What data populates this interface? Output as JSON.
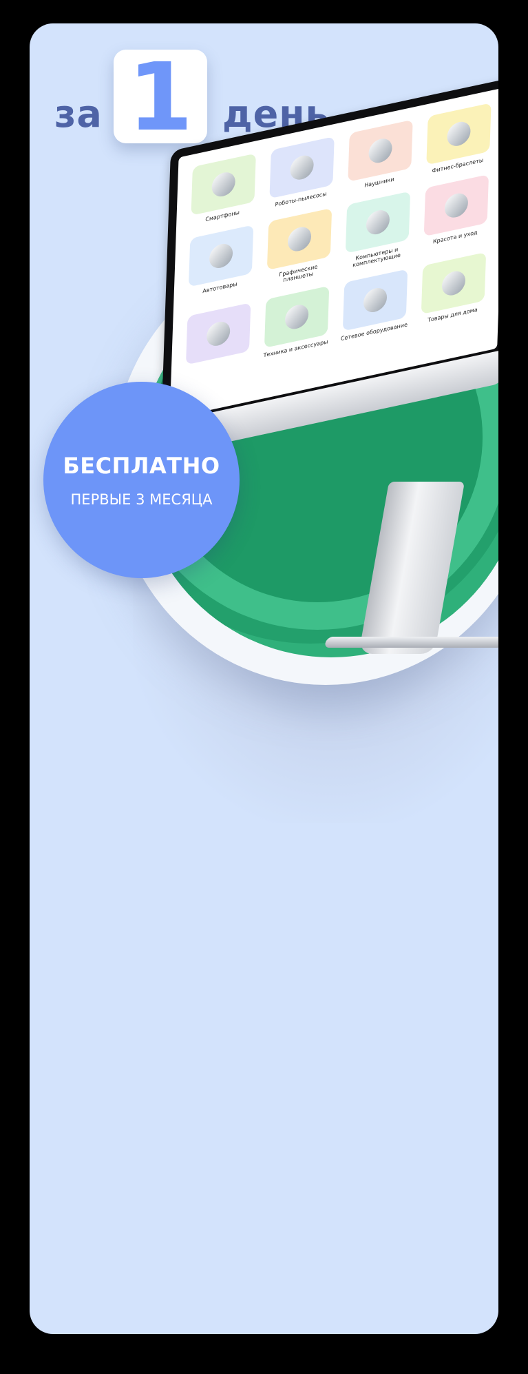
{
  "headline": {
    "prefix": "за",
    "number": "1",
    "suffix": "день"
  },
  "badge": {
    "title": "БЕСПЛАТНО",
    "subtitle": "ПЕРВЫЕ 3 МЕСЯЦА"
  },
  "screen": {
    "categories": [
      {
        "label": "Смартфоны",
        "color": "#e3f5d5",
        "icon": "smartphone-icon"
      },
      {
        "label": "Роботы-пылесосы",
        "color": "#dde4fb",
        "icon": "robot-vacuum-icon"
      },
      {
        "label": "Наушники",
        "color": "#fbe0d6",
        "icon": "earbuds-icon"
      },
      {
        "label": "Фитнес-браслеты",
        "color": "#fbf2b8",
        "icon": "fitness-band-icon"
      },
      {
        "label": "Автотовары",
        "color": "#dceafc",
        "icon": "car-mount-icon"
      },
      {
        "label": "Графические планшеты",
        "color": "#fde9b7",
        "icon": "tablet-icon"
      },
      {
        "label": "Компьютеры и комплектующие",
        "color": "#d8f5ea",
        "icon": "mouse-icon"
      },
      {
        "label": "Красота и уход",
        "color": "#fbdce3",
        "icon": "mirror-icon"
      },
      {
        "label": "",
        "color": "#e6def9",
        "icon": "washing-machine-icon"
      },
      {
        "label": "Техника и аксессуары",
        "color": "#d4f2d6",
        "icon": "accessories-icon"
      },
      {
        "label": "Сетевое оборудование",
        "color": "#d8e6fb",
        "icon": "router-icon"
      },
      {
        "label": "Товары для дома",
        "color": "#e7f7d1",
        "icon": "smart-home-icon"
      }
    ]
  }
}
